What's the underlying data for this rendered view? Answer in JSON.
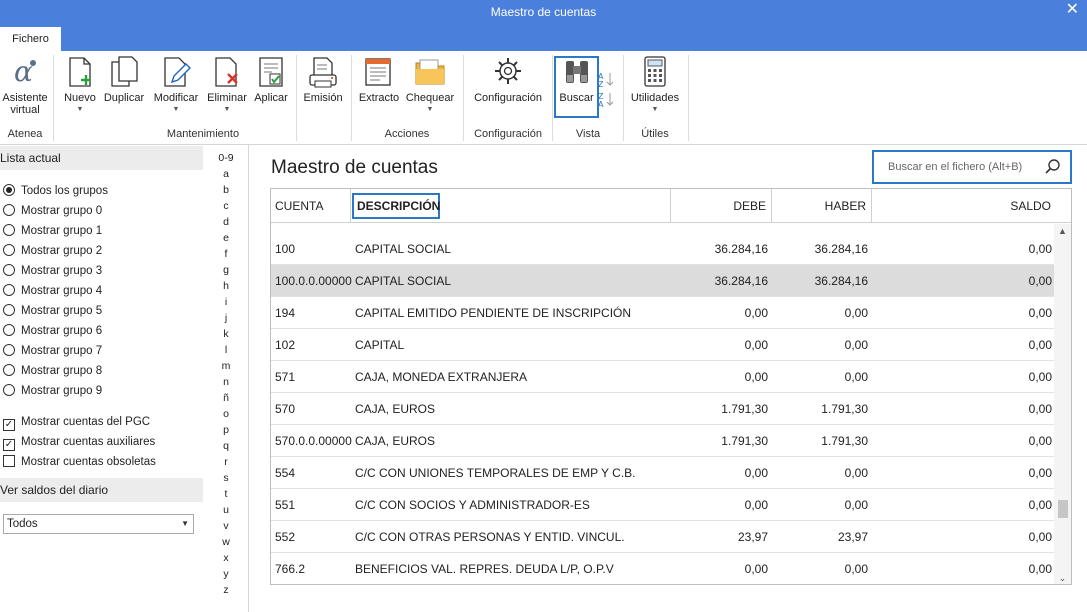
{
  "window": {
    "title": "Maestro de cuentas",
    "close_glyph": "✕"
  },
  "tabs": [
    {
      "label": "Fichero"
    }
  ],
  "ribbon": {
    "buttons": {
      "asistente": "Asistente\nvirtual",
      "asistente_l1": "Asistente",
      "asistente_l2": "virtual",
      "nuevo": "Nuevo",
      "duplicar": "Duplicar",
      "modificar": "Modificar",
      "eliminar": "Eliminar",
      "aplicar": "Aplicar",
      "emision": "Emisión",
      "extracto": "Extracto",
      "chequear": "Chequear",
      "configuracion": "Configuración",
      "buscar": "Buscar",
      "utilidades": "Utilidades"
    },
    "groups": {
      "atenea": "Atenea",
      "mantenimiento": "Mantenimiento",
      "acciones": "Acciones",
      "configuracion": "Configuración",
      "vista": "Vista",
      "utiles": "Útiles"
    }
  },
  "left_panel": {
    "lista_actual": "Lista actual",
    "groups": [
      {
        "label": "Todos los grupos",
        "selected": true
      },
      {
        "label": "Mostrar grupo 0",
        "selected": false
      },
      {
        "label": "Mostrar grupo 1",
        "selected": false
      },
      {
        "label": "Mostrar grupo 2",
        "selected": false
      },
      {
        "label": "Mostrar grupo 3",
        "selected": false
      },
      {
        "label": "Mostrar grupo 4",
        "selected": false
      },
      {
        "label": "Mostrar grupo 5",
        "selected": false
      },
      {
        "label": "Mostrar grupo 6",
        "selected": false
      },
      {
        "label": "Mostrar grupo 7",
        "selected": false
      },
      {
        "label": "Mostrar grupo 8",
        "selected": false
      },
      {
        "label": "Mostrar grupo 9",
        "selected": false
      }
    ],
    "checks": [
      {
        "label": "Mostrar cuentas del PGC",
        "checked": true
      },
      {
        "label": "Mostrar cuentas auxiliares",
        "checked": true
      },
      {
        "label": "Mostrar cuentas obsoletas",
        "checked": false
      }
    ],
    "ver_saldos": "Ver saldos del diario",
    "saldos_select": "Todos"
  },
  "alphabet": [
    "0-9",
    "a",
    "b",
    "c",
    "d",
    "e",
    "f",
    "g",
    "h",
    "i",
    "j",
    "k",
    "l",
    "m",
    "n",
    "ñ",
    "o",
    "p",
    "q",
    "r",
    "s",
    "t",
    "u",
    "v",
    "w",
    "x",
    "y",
    "z"
  ],
  "main": {
    "title": "Maestro de cuentas",
    "search_placeholder": "Buscar en el fichero (Alt+B)"
  },
  "table": {
    "headers": {
      "cuenta": "CUENTA",
      "descripcion": "DESCRIPCIÓN",
      "debe": "DEBE",
      "haber": "HABER",
      "saldo": "SALDO"
    },
    "rows": [
      {
        "cuenta": "100",
        "descripcion": "CAPITAL SOCIAL",
        "debe": "36.284,16",
        "haber": "36.284,16",
        "saldo": "0,00"
      },
      {
        "cuenta": "100.0.0.00000",
        "descripcion": "CAPITAL SOCIAL",
        "debe": "36.284,16",
        "haber": "36.284,16",
        "saldo": "0,00",
        "selected": true
      },
      {
        "cuenta": "194",
        "descripcion": "CAPITAL EMITIDO PENDIENTE DE INSCRIPCIÓN",
        "debe": "0,00",
        "haber": "0,00",
        "saldo": "0,00"
      },
      {
        "cuenta": "102",
        "descripcion": "CAPITAL",
        "debe": "0,00",
        "haber": "0,00",
        "saldo": "0,00"
      },
      {
        "cuenta": "571",
        "descripcion": "CAJA, MONEDA EXTRANJERA",
        "debe": "0,00",
        "haber": "0,00",
        "saldo": "0,00"
      },
      {
        "cuenta": "570",
        "descripcion": "CAJA, EUROS",
        "debe": "1.791,30",
        "haber": "1.791,30",
        "saldo": "0,00"
      },
      {
        "cuenta": "570.0.0.00000",
        "descripcion": "CAJA, EUROS",
        "debe": "1.791,30",
        "haber": "1.791,30",
        "saldo": "0,00"
      },
      {
        "cuenta": "554",
        "descripcion": "C/C CON UNIONES TEMPORALES DE EMP Y C.B.",
        "debe": "0,00",
        "haber": "0,00",
        "saldo": "0,00"
      },
      {
        "cuenta": "551",
        "descripcion": "C/C CON SOCIOS Y ADMINISTRADOR-ES",
        "debe": "0,00",
        "haber": "0,00",
        "saldo": "0,00"
      },
      {
        "cuenta": "552",
        "descripcion": "C/C CON OTRAS PERSONAS Y ENTID. VINCUL.",
        "debe": "23,97",
        "haber": "23,97",
        "saldo": "0,00"
      },
      {
        "cuenta": "766.2",
        "descripcion": "BENEFICIOS VAL. REPRES. DEUDA L/P, O.P.V",
        "debe": "0,00",
        "haber": "0,00",
        "saldo": "0,00"
      }
    ]
  },
  "colors": {
    "accent": "#4a7fdc",
    "focus": "#2b78c5",
    "selected_row": "#dcdcdc"
  }
}
